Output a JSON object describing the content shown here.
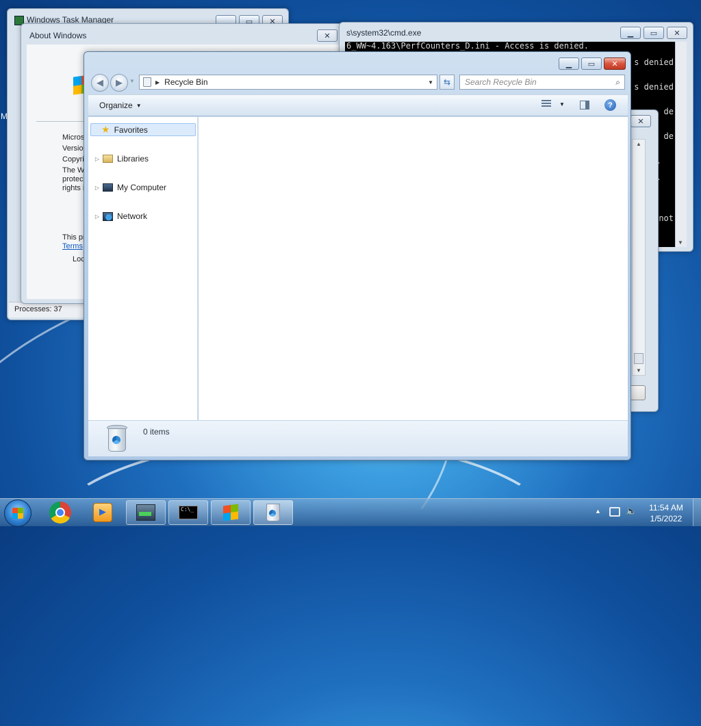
{
  "desktop": {
    "taskmgr": {
      "title": "Windows Task Manager",
      "status": "Processes: 37"
    },
    "about": {
      "title": "About Windows",
      "lines": [
        "Microso",
        "Version",
        "Copyri",
        "The W",
        "protec",
        "rights i"
      ],
      "line_product": "This pr",
      "link_terms": "Terms",
      "line_loc": "Loc"
    },
    "cmd": {
      "title": "s\\system32\\cmd.exe",
      "lines": [
        "6_WW~4.163\\PerfCounters_D.ini - Access is denied.",
        "s denied",
        "s denied",
        "de",
        "de",
        ".",
        ".",
        "not"
      ]
    },
    "left_letter": "M"
  },
  "explorer": {
    "address": "Recycle Bin",
    "search_placeholder": "Search Recycle Bin",
    "toolbar": {
      "organize": "Organize"
    },
    "nav": {
      "favorites": "Favorites",
      "libraries": "Libraries",
      "computer": "My Computer",
      "network": "Network"
    },
    "status": "0 items"
  },
  "taskbar": {
    "time": "11:54 AM",
    "date": "1/5/2022"
  },
  "colors": {
    "accent": "#1f6fbf",
    "close": "#c13a24",
    "selection": "#dcebfc"
  }
}
